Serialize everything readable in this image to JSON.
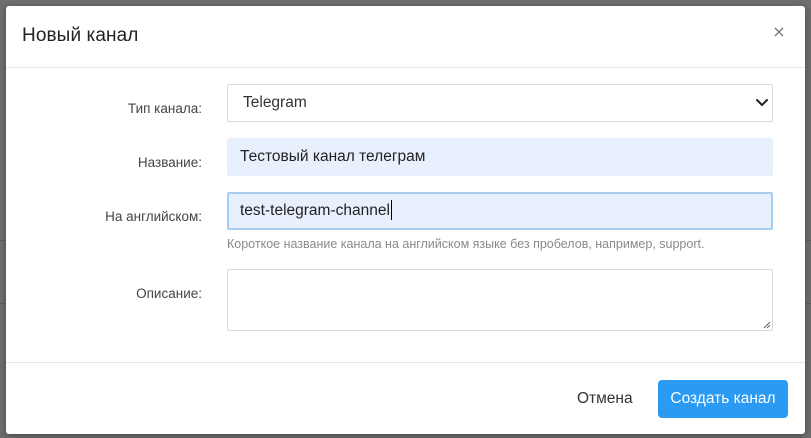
{
  "modal": {
    "title": "Новый канал",
    "close_symbol": "×",
    "close_icon": "close-icon"
  },
  "form": {
    "channel_type": {
      "label": "Тип канала:",
      "selected": "Telegram",
      "icon": "chevron-down-icon"
    },
    "name": {
      "label": "Название:",
      "value": "Тестовый канал телеграм"
    },
    "english_name": {
      "label": "На английском:",
      "value": "test-telegram-channel",
      "help": "Короткое название канала на английском языке без пробелов, например, support."
    },
    "description": {
      "label": "Описание:",
      "value": ""
    }
  },
  "footer": {
    "cancel_label": "Отмена",
    "submit_label": "Создать канал"
  },
  "colors": {
    "primary": "#2a9af3",
    "autofill_bg": "#e8f0fe",
    "focus_border": "#a9cdf0",
    "backdrop": "#6f6f6f"
  }
}
